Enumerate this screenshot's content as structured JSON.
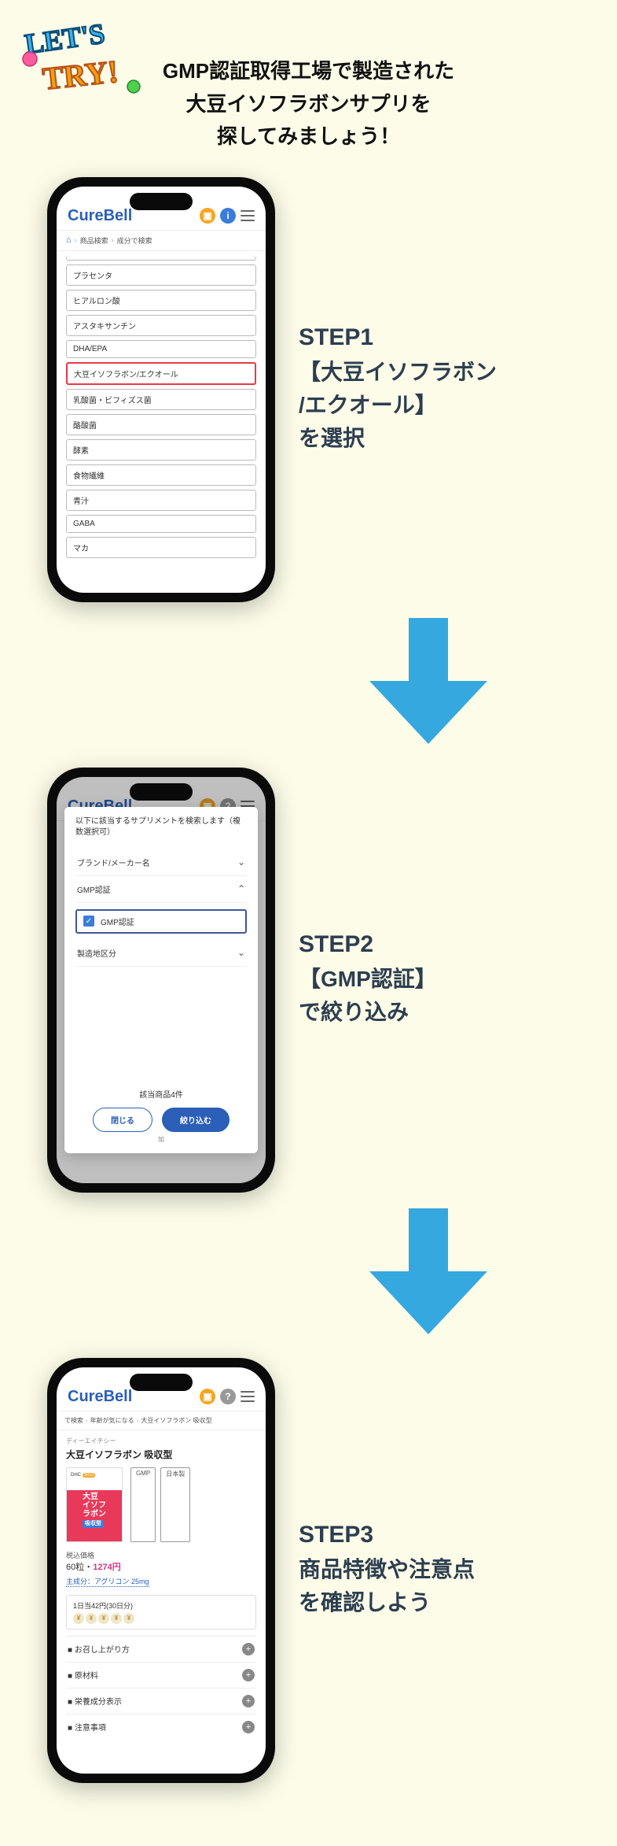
{
  "hero": {
    "line1": "GMP認証取得工場で製造された",
    "line2": "大豆イソフラボンサプリを",
    "line3": "探してみましょう！"
  },
  "app": {
    "logo": "CureBell",
    "breadcrumb1": {
      "home": "🏠",
      "p1": "商品検索",
      "p2": "成分で検索"
    }
  },
  "step1": {
    "label": "STEP1",
    "desc1": "【大豆イソフラボン",
    "desc2": "/エクオール】",
    "desc3": "を選択",
    "items": [
      "プラセンタ",
      "ヒアルロン酸",
      "アスタキサンチン",
      "DHA/EPA",
      "大豆イソフラボン/エクオール",
      "乳酸菌・ビフィズス菌",
      "酪酸菌",
      "酵素",
      "食物繊維",
      "青汁",
      "GABA",
      "マカ"
    ]
  },
  "step2": {
    "label": "STEP2",
    "desc1": "【GMP認証】",
    "desc2": "で絞り込み",
    "modalTitle": "以下に該当するサプリメントを検索します（複数選択可）",
    "filter1": "ブランド/メーカー名",
    "filter2": "GMP認証",
    "check": "GMP認証",
    "filter3": "製造地区分",
    "count": "該当商品4件",
    "btnClose": "閉じる",
    "btnApply": "絞り込む",
    "sub": "加"
  },
  "step3": {
    "label": "STEP3",
    "desc1": "商品特徴や注意点",
    "desc2": "を確認しよう",
    "bc": {
      "p1": "で検索",
      "p2": "年齢が気になる",
      "p3": "大豆イソフラボン 吸収型"
    },
    "brand": "ディーエイチシー",
    "name": "大豆イソフラボン 吸収型",
    "imgBrand": "DHC",
    "imgPill": "30日",
    "imgText1": "大豆",
    "imgText2": "イソフ",
    "imgText3": "ラボン",
    "imgText4": "吸収型",
    "badge1": "GMP",
    "badge2": "日本製",
    "priceLabel": "税込価格",
    "priceText": "60粒・",
    "priceVal": "1274円",
    "ingredient": "主成分：アグリコン 25mg",
    "daily": "1日当42円(30日分)",
    "acc": [
      "お召し上がり方",
      "原材料",
      "栄養成分表示",
      "注意事項"
    ]
  }
}
